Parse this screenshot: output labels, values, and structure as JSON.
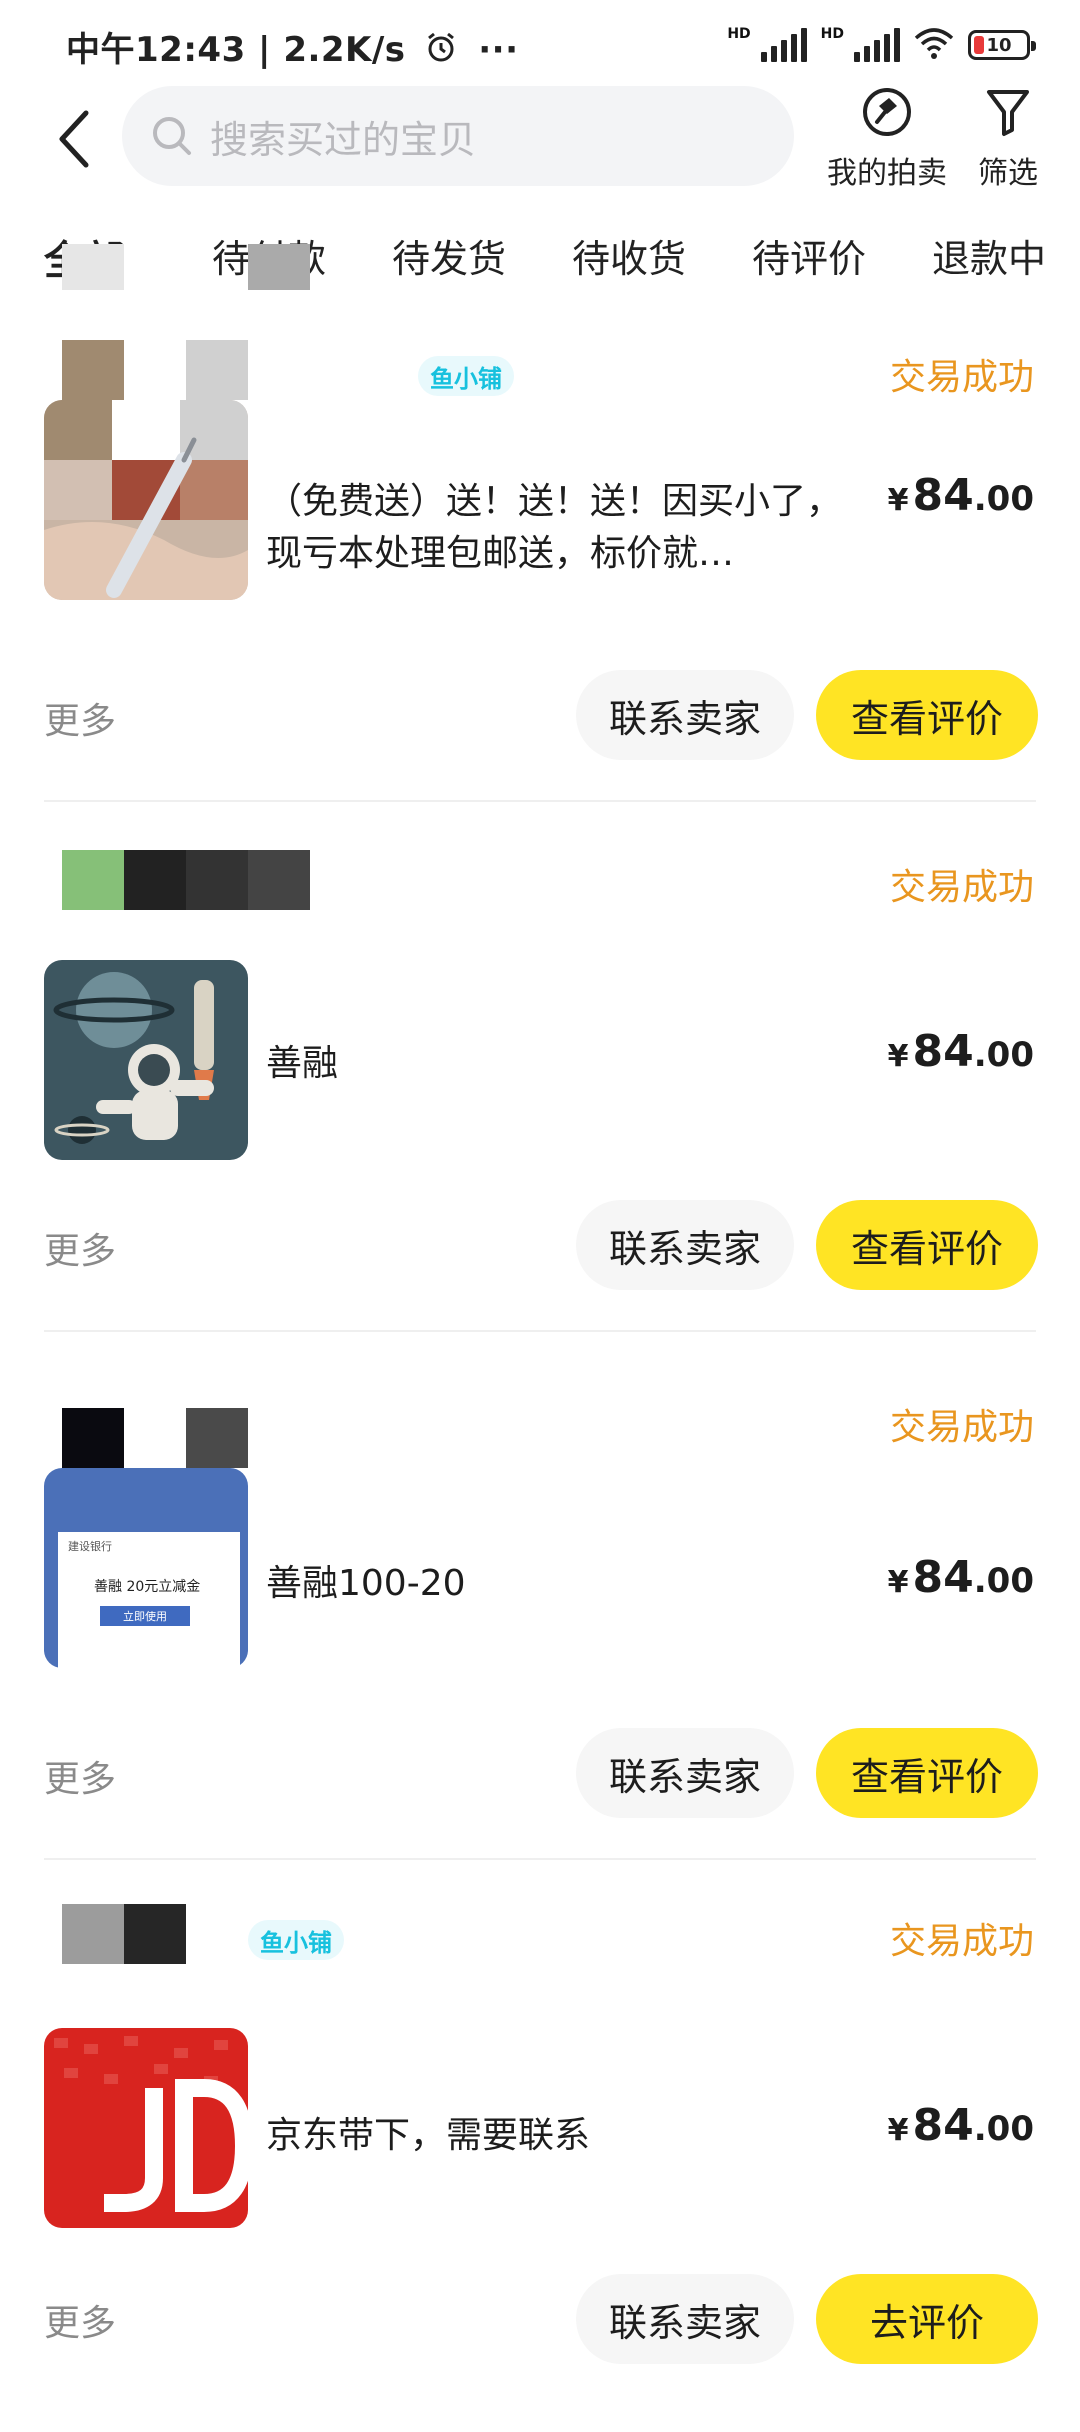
{
  "status_bar": {
    "time_text": "中午12:43 | 2.2K/s",
    "more": "···",
    "network1": "HD",
    "network2": "HD",
    "battery": "10"
  },
  "header": {
    "search_placeholder": "搜索买过的宝贝",
    "auction_label": "我的拍卖",
    "filter_label": "筛选"
  },
  "tabs": [
    {
      "label": "全部"
    },
    {
      "label": "待付款"
    },
    {
      "label": "待发货"
    },
    {
      "label": "待收货"
    },
    {
      "label": "待评价"
    },
    {
      "label": "退款中"
    }
  ],
  "orders": [
    {
      "shop_tag": "鱼小铺",
      "status": "交易成功",
      "title": "（免费送）送！送！送！因买小了，现亏本处理包邮送，标价就…",
      "price_symbol": "¥",
      "price_int": "84",
      "price_dec": ".00",
      "more": "更多",
      "contact": "联系卖家",
      "action": "查看评价",
      "thumb_icon": "screwdriver-photo"
    },
    {
      "shop_tag": "",
      "status": "交易成功",
      "title": "善融",
      "price_symbol": "¥",
      "price_int": "84",
      "price_dec": ".00",
      "more": "更多",
      "contact": "联系卖家",
      "action": "查看评价",
      "thumb_icon": "astronaut-illustration"
    },
    {
      "shop_tag": "",
      "status": "交易成功",
      "title": "善融100-20",
      "price_symbol": "¥",
      "price_int": "84",
      "price_dec": ".00",
      "more": "更多",
      "contact": "联系卖家",
      "action": "查看评价",
      "thumb_icon": "bank-coupon-screenshot",
      "thumb_bank": "建设银行",
      "thumb_coupon": "善融 20元立减金",
      "thumb_button": "立即使用"
    },
    {
      "shop_tag": "鱼小铺",
      "status": "交易成功",
      "title": "京东带下，需要联系",
      "price_symbol": "¥",
      "price_int": "84",
      "price_dec": ".00",
      "more": "更多",
      "contact": "联系卖家",
      "action": "去评价",
      "thumb_icon": "jd-card-image"
    }
  ],
  "colors": {
    "accent_yellow": "#ffe424",
    "status_orange": "#e9961f",
    "tag_cyan": "#17c1de"
  }
}
